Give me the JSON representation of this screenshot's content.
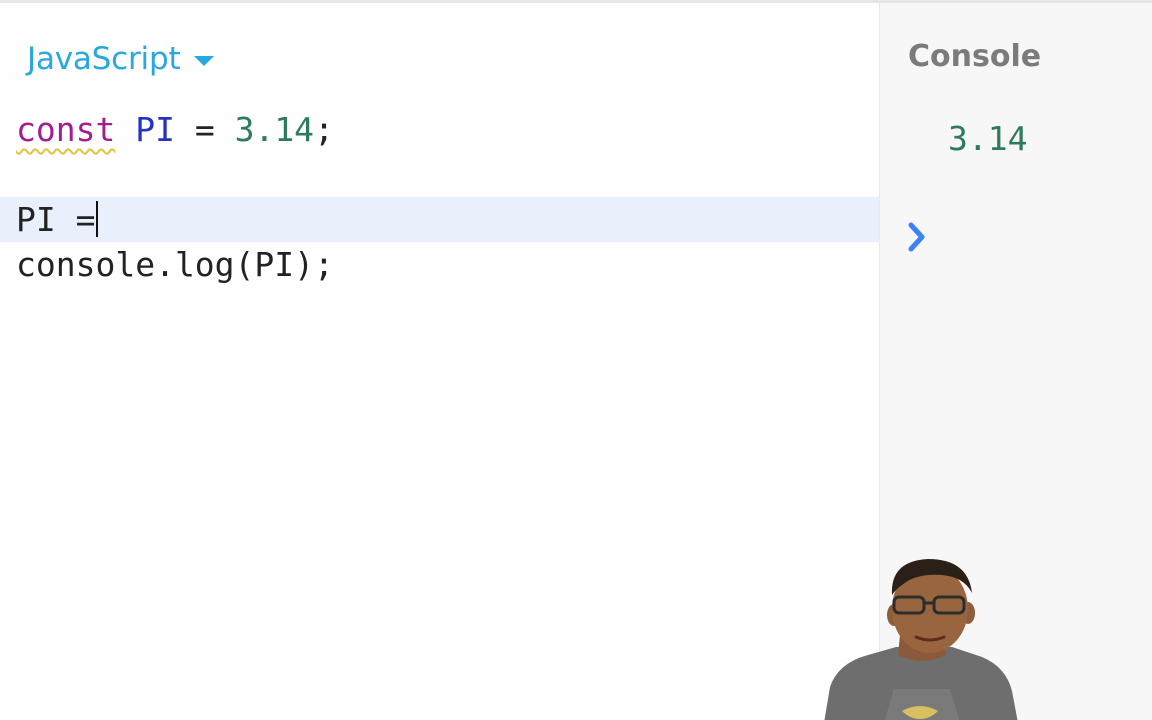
{
  "editor": {
    "language": "JavaScript",
    "lines": [
      {
        "keyword": "const",
        "identifier": "PI",
        "operator": " = ",
        "number": "3.14",
        "end": ";"
      },
      {
        "text": ""
      },
      {
        "text": "PI ="
      },
      {
        "text": "console.log(PI);"
      }
    ]
  },
  "console": {
    "title": "Console",
    "output": "3.14",
    "prompt_icon": "chevron-right-icon"
  },
  "colors": {
    "accent": "#29a8e0",
    "keyword": "#a41e91",
    "identifier": "#2431c4",
    "number": "#2e7a5c",
    "active_line": "#e9f0fc",
    "prompt": "#3b82f6"
  },
  "webcam": {
    "icon": "presenter-webcam"
  }
}
